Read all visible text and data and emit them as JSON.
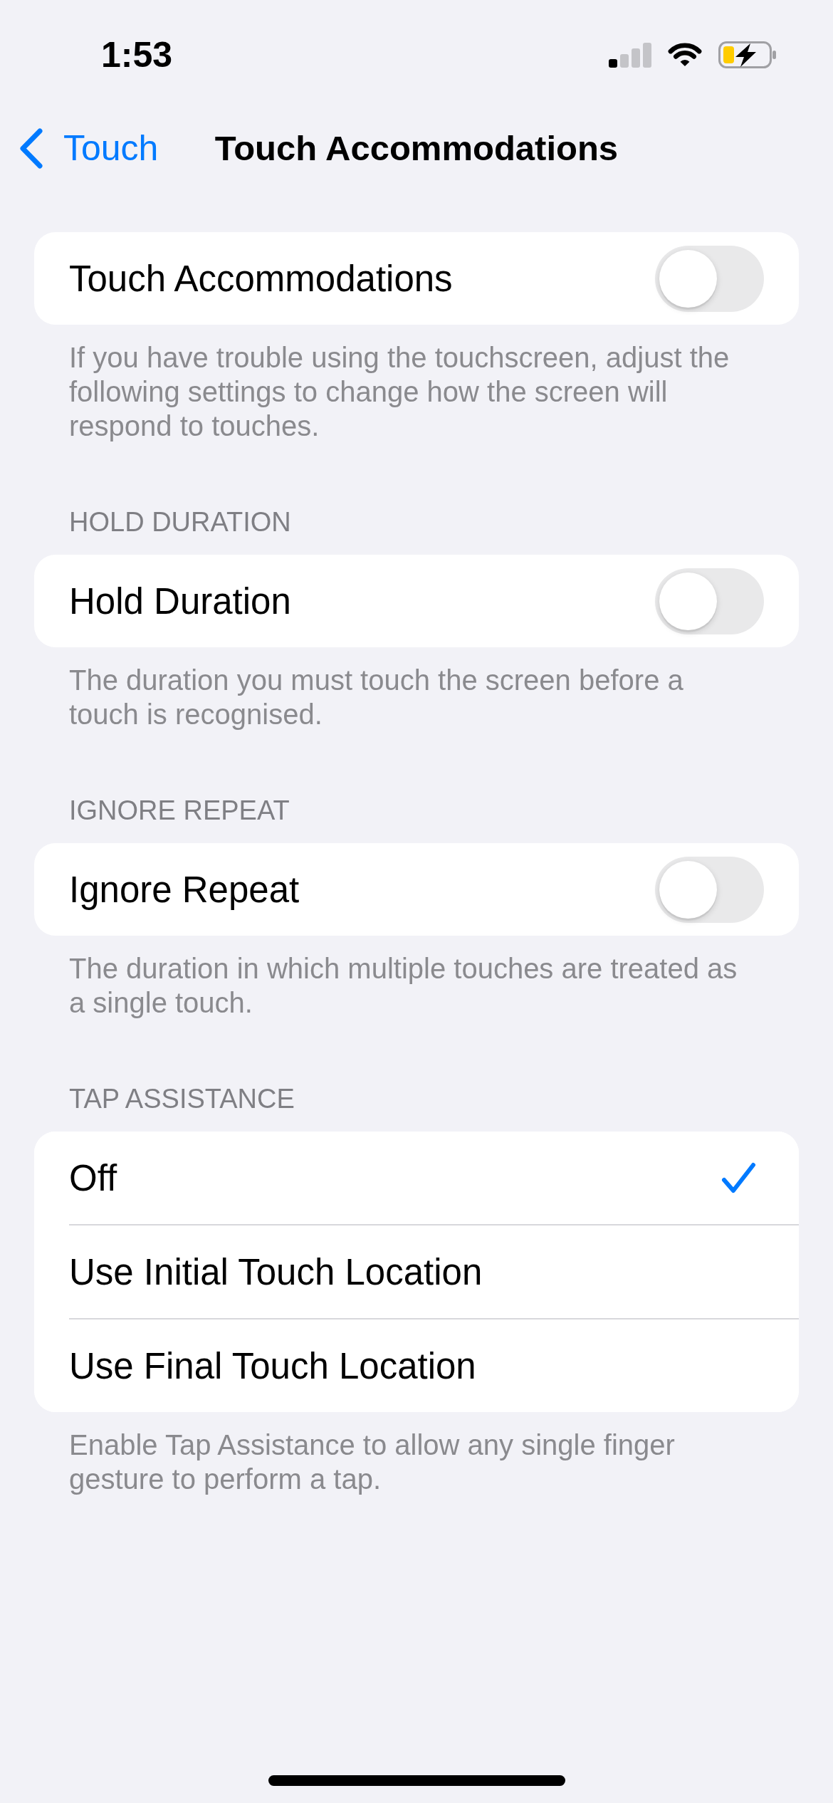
{
  "status_bar": {
    "time": "1:53"
  },
  "nav": {
    "back": "Touch",
    "title": "Touch Accommodations"
  },
  "sections": [
    {
      "rows": [
        {
          "kind": "toggle",
          "label": "Touch Accommodations",
          "on": false
        }
      ],
      "footer": "If you have trouble using the touchscreen, adjust the following settings to change how the screen will respond to touches."
    },
    {
      "header": "HOLD DURATION",
      "rows": [
        {
          "kind": "toggle",
          "label": "Hold Duration",
          "on": false
        }
      ],
      "footer": "The duration you must touch the screen before a touch is recognised."
    },
    {
      "header": "IGNORE REPEAT",
      "rows": [
        {
          "kind": "toggle",
          "label": "Ignore Repeat",
          "on": false
        }
      ],
      "footer": "The duration in which multiple touches are treated as a single touch."
    },
    {
      "header": "TAP ASSISTANCE",
      "rows": [
        {
          "kind": "choice",
          "label": "Off",
          "selected": true
        },
        {
          "kind": "choice",
          "label": "Use Initial Touch Location",
          "selected": false
        },
        {
          "kind": "choice",
          "label": "Use Final Touch Location",
          "selected": false
        }
      ],
      "footer": "Enable Tap Assistance to allow any single finger gesture to perform a tap."
    }
  ]
}
